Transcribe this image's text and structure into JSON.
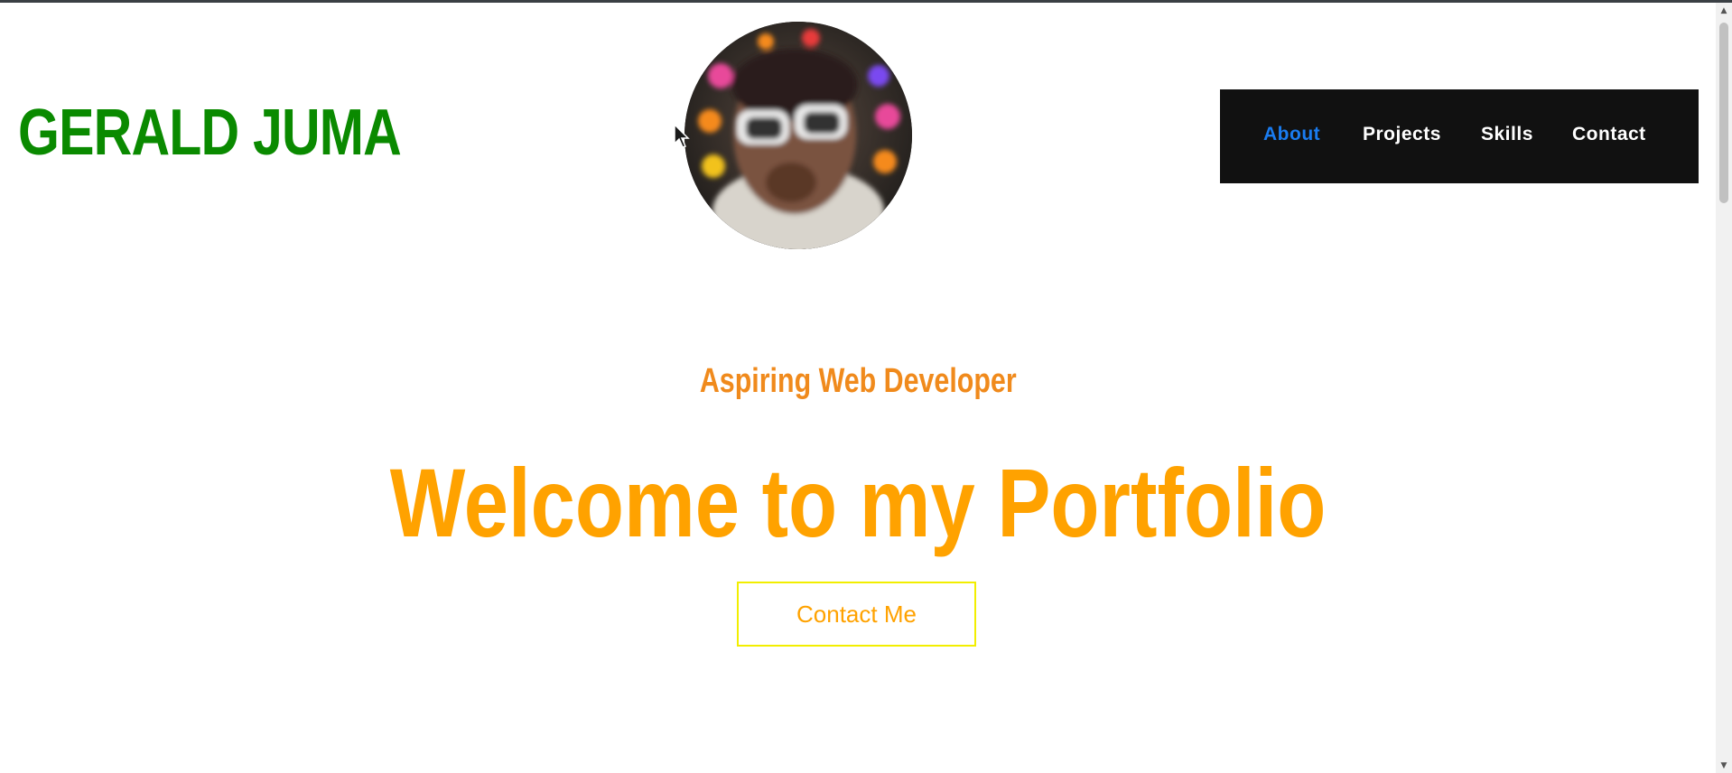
{
  "header": {
    "brand": "GERALD JUMA",
    "avatar_alt": "profile-photo"
  },
  "nav": {
    "items": [
      {
        "label": "About",
        "active": true
      },
      {
        "label": "Projects",
        "active": false
      },
      {
        "label": "Skills",
        "active": false
      },
      {
        "label": "Contact",
        "active": false
      }
    ]
  },
  "hero": {
    "subtitle": "Aspiring Web Developer",
    "headline": "Welcome to my Portfolio",
    "cta_label": "Contact Me"
  },
  "colors": {
    "brand": "#0a8a00",
    "nav_bg": "#111111",
    "nav_active": "#1a7cf0",
    "subtitle": "#f08a1c",
    "headline": "#ffa200",
    "cta_border": "#f2ee00"
  },
  "scrollbar": {
    "up_icon": "chevron-up-icon",
    "down_icon": "chevron-down-icon"
  }
}
